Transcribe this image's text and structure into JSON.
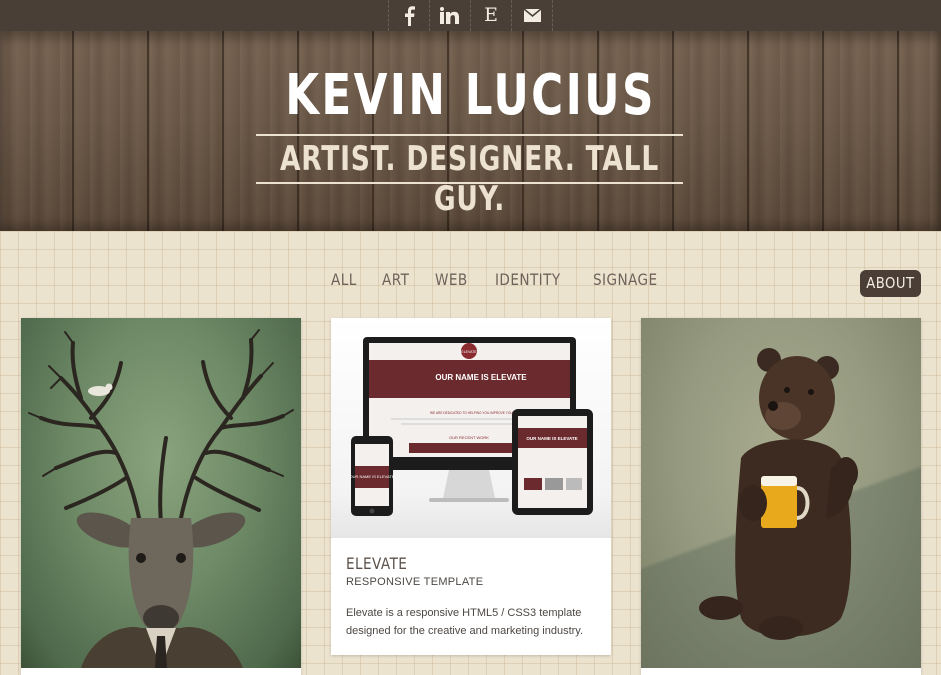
{
  "social": {
    "facebook_icon": "facebook-icon",
    "linkedin_icon": "linkedin-icon",
    "etsy_letter": "E",
    "email_icon": "envelope-icon"
  },
  "header": {
    "name": "KEVIN LUCIUS",
    "tagline": "ARTIST. DESIGNER. TALL GUY."
  },
  "nav": {
    "items": [
      "ALL",
      "ART",
      "WEB",
      "IDENTITY",
      "SIGNAGE"
    ],
    "about": "ABOUT"
  },
  "cards": [
    {
      "image": "deer-with-branch-antlers-illustration"
    },
    {
      "image": "elevate-responsive-template-devices",
      "title": "ELEVATE",
      "subtitle": "RESPONSIVE TEMPLATE",
      "description": "Elevate is a responsive HTML5 / CSS3 template designed for the creative and marketing industry.",
      "mock": {
        "logo": "ELEVATE",
        "hero": "OUR NAME IS ELEVATE",
        "tagline_small": "WE ARE DEDICATED TO HELPING YOU IMPROVE YOUR BUSINESS",
        "recent": "OUR RECENT WORK",
        "phone_hero": "OUR NAME IS ELEVATE"
      }
    },
    {
      "image": "bear-holding-beer-mug-illustration"
    }
  ],
  "colors": {
    "topbar": "#4a3f37",
    "wood": "#6b5847",
    "paper": "#ece3cf",
    "about_bg": "#4a3e37",
    "accent_red": "#8a2c2f"
  }
}
